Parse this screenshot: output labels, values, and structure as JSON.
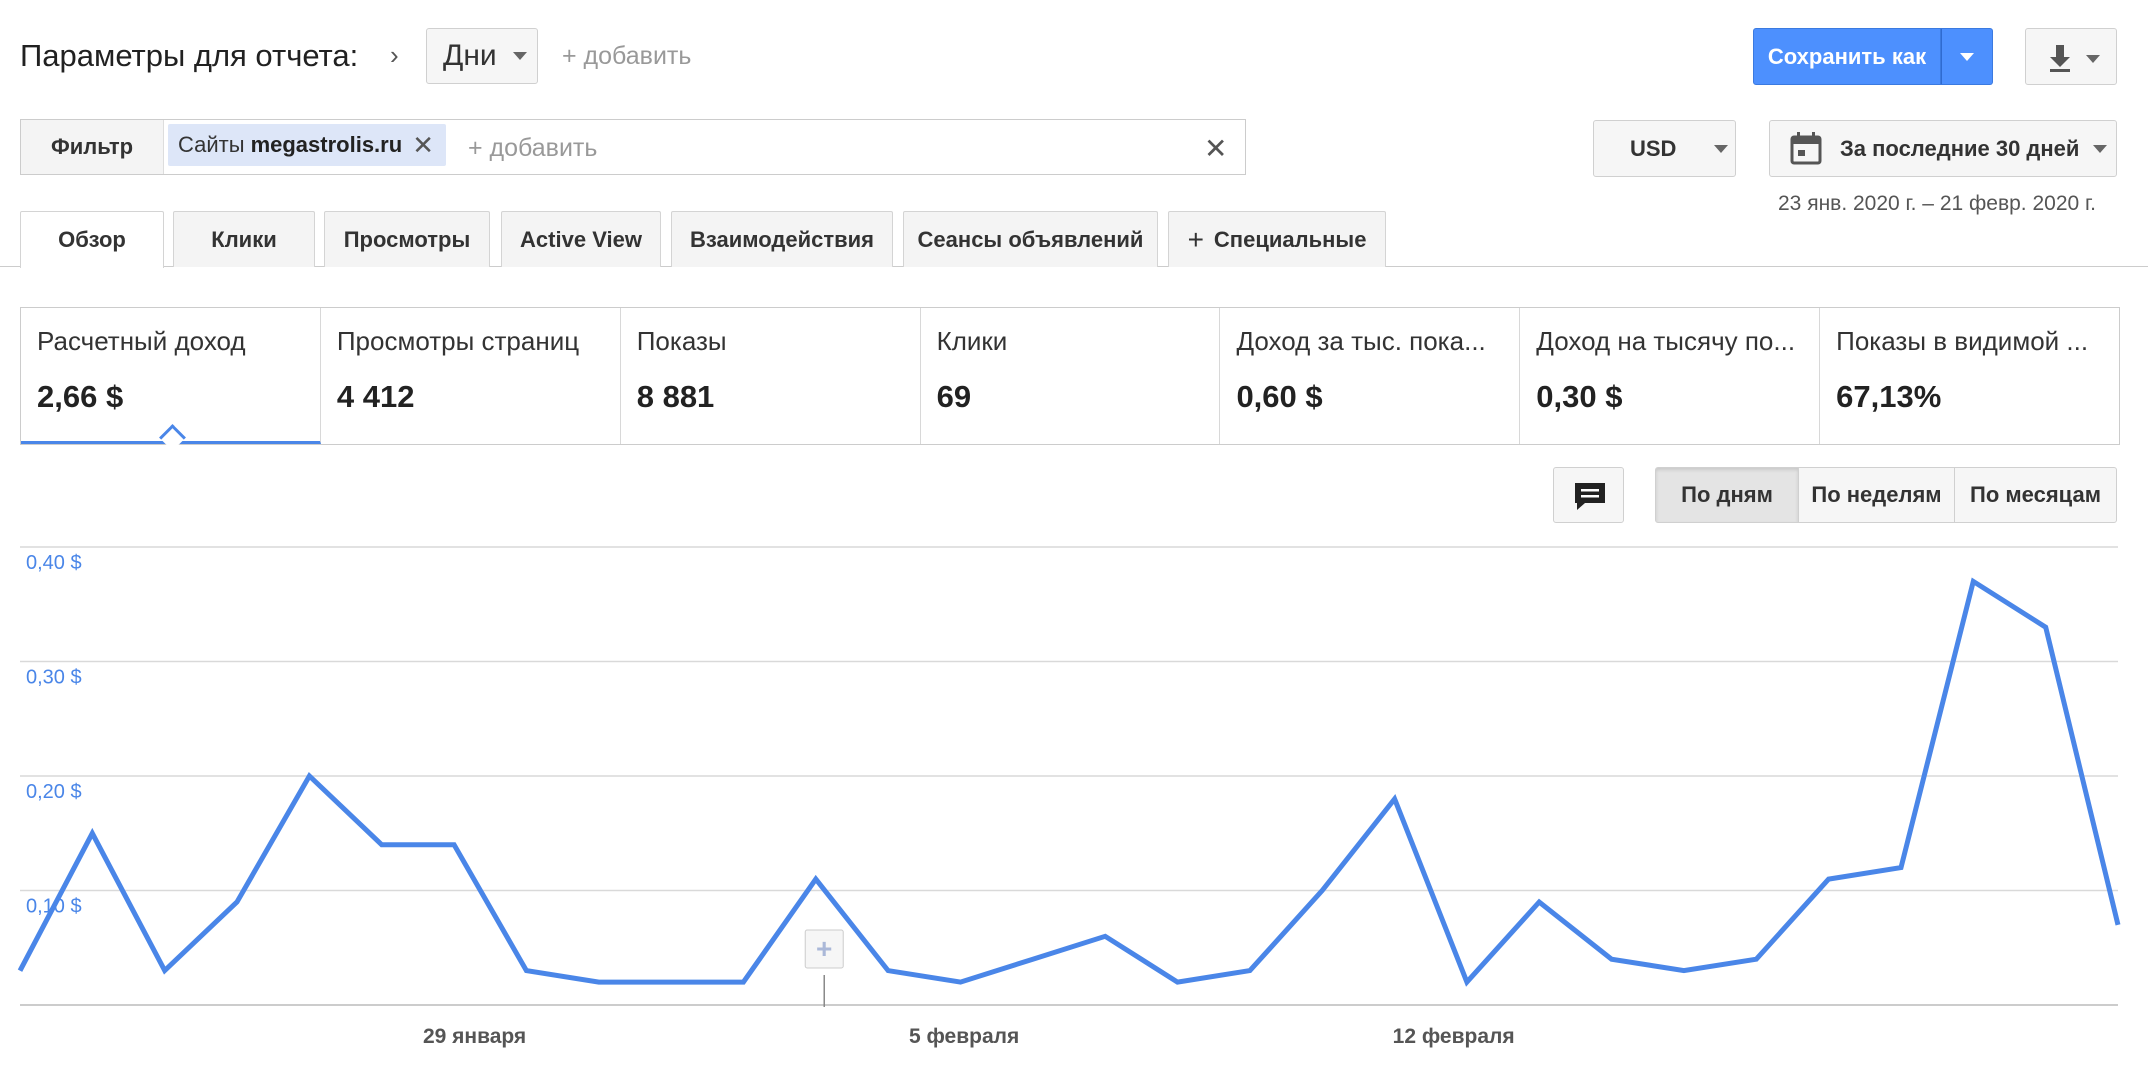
{
  "header": {
    "title": "Параметры для отчета:",
    "dimension": "Дни",
    "add_label": "+ добавить",
    "save_label": "Сохранить как"
  },
  "filter": {
    "label": "Фильтр",
    "chip_label": "Сайты",
    "chip_value": "megastrolis.ru",
    "add_label": "+ добавить"
  },
  "currency": "USD",
  "date_range": {
    "label": "За последние 30 дней",
    "sub": "23 янв. 2020 г. – 21 февр. 2020 г."
  },
  "tabs": [
    {
      "label": "Обзор",
      "active": true
    },
    {
      "label": "Клики"
    },
    {
      "label": "Просмотры"
    },
    {
      "label": "Active View"
    },
    {
      "label": "Взаимодействия"
    },
    {
      "label": "Сеансы объявлений"
    },
    {
      "label": "Специальные",
      "icon": "plus-icon"
    }
  ],
  "kpis": [
    {
      "title": "Расчетный доход",
      "value": "2,66 $",
      "selected": true
    },
    {
      "title": "Просмотры страниц",
      "value": "4 412"
    },
    {
      "title": "Показы",
      "value": "8 881"
    },
    {
      "title": "Клики",
      "value": "69"
    },
    {
      "title": "Доход за тыс. пока...",
      "value": "0,60 $"
    },
    {
      "title": "Доход на тысячу по...",
      "value": "0,30 $"
    },
    {
      "title": "Показы в видимой ...",
      "value": "67,13%"
    }
  ],
  "granularity": {
    "days": "По дням",
    "weeks": "По неделям",
    "months": "По месяцам",
    "selected": "days"
  },
  "chart_data": {
    "type": "line",
    "x": [
      "2020-01-23",
      "2020-01-24",
      "2020-01-25",
      "2020-01-26",
      "2020-01-27",
      "2020-01-28",
      "2020-01-29",
      "2020-01-30",
      "2020-01-31",
      "2020-02-01",
      "2020-02-02",
      "2020-02-03",
      "2020-02-04",
      "2020-02-05",
      "2020-02-06",
      "2020-02-07",
      "2020-02-08",
      "2020-02-09",
      "2020-02-10",
      "2020-02-11",
      "2020-02-12",
      "2020-02-13",
      "2020-02-14",
      "2020-02-15",
      "2020-02-16",
      "2020-02-17",
      "2020-02-18",
      "2020-02-19",
      "2020-02-20",
      "2020-02-21"
    ],
    "values": [
      0.15,
      0.03,
      0.09,
      0.2,
      0.14,
      0.14,
      0.03,
      0.02,
      0.02,
      0.02,
      0.11,
      0.03,
      0.02,
      0.04,
      0.06,
      0.02,
      0.03,
      0.1,
      0.18,
      0.02,
      0.09,
      0.04,
      0.03,
      0.04,
      0.11,
      0.12,
      0.37,
      0.33,
      0.07
    ],
    "start_value": 0.03,
    "y_ticks": [
      "0,10 $",
      "0,20 $",
      "0,30 $",
      "0,40 $"
    ],
    "y_tick_values": [
      0.1,
      0.2,
      0.3,
      0.4
    ],
    "x_tick_labels": [
      {
        "label": "29 января",
        "date": "2020-01-29"
      },
      {
        "label": "5 февраля",
        "date": "2020-02-05"
      },
      {
        "label": "12 февраля",
        "date": "2020-02-12"
      }
    ],
    "ylim": [
      0,
      0.4
    ],
    "color": "#4a86e8",
    "grid": true
  }
}
